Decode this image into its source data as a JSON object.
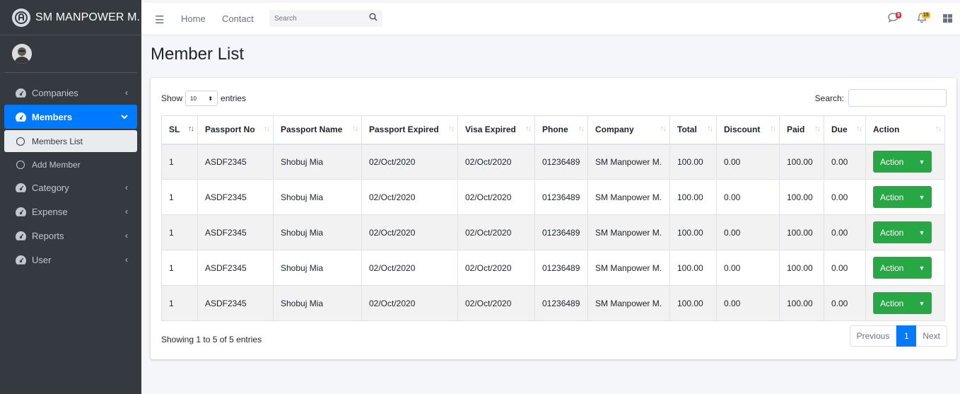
{
  "brand": {
    "name": "SM MANPOWER M."
  },
  "sidebar": {
    "items": [
      {
        "label": "Companies",
        "icon": "dashboard-icon",
        "active": false
      },
      {
        "label": "Members",
        "icon": "dashboard-icon",
        "active": true
      },
      {
        "label": "Category",
        "icon": "dashboard-icon",
        "active": false
      },
      {
        "label": "Expense",
        "icon": "dashboard-icon",
        "active": false
      },
      {
        "label": "Reports",
        "icon": "dashboard-icon",
        "active": false
      },
      {
        "label": "User",
        "icon": "dashboard-icon",
        "active": false
      }
    ],
    "subitems": [
      {
        "label": "Members List",
        "current": true
      },
      {
        "label": "Add Member",
        "current": false
      }
    ]
  },
  "topnav": {
    "home": "Home",
    "contact": "Contact",
    "search_placeholder": "Search",
    "messages_badge": "3",
    "notifications_badge": "15",
    "colors": {
      "messages_badge": "#dc3545",
      "notifications_badge": "#ffc107"
    }
  },
  "page": {
    "title": "Member List"
  },
  "table_controls": {
    "show_label": "Show",
    "entries_value": "10",
    "entries_label": "entries",
    "search_label": "Search:"
  },
  "table": {
    "columns": [
      "SL",
      "Passport No",
      "Passport Name",
      "Passport Expired",
      "Visa Expired",
      "Phone",
      "Company",
      "Total",
      "Discount",
      "Paid",
      "Due",
      "Action"
    ],
    "rows": [
      {
        "sl": "1",
        "passport_no": "ASDF2345",
        "passport_name": "Shobuj Mia",
        "passport_expired": "02/Oct/2020",
        "visa_expired": "02/Oct/2020",
        "phone": "01236489",
        "company": "SM Manpower M.",
        "total": "100.00",
        "discount": "0.00",
        "paid": "100.00",
        "due": "0.00",
        "action": "Action"
      },
      {
        "sl": "1",
        "passport_no": "ASDF2345",
        "passport_name": "Shobuj Mia",
        "passport_expired": "02/Oct/2020",
        "visa_expired": "02/Oct/2020",
        "phone": "01236489",
        "company": "SM Manpower M.",
        "total": "100.00",
        "discount": "0.00",
        "paid": "100.00",
        "due": "0.00",
        "action": "Action"
      },
      {
        "sl": "1",
        "passport_no": "ASDF2345",
        "passport_name": "Shobuj Mia",
        "passport_expired": "02/Oct/2020",
        "visa_expired": "02/Oct/2020",
        "phone": "01236489",
        "company": "SM Manpower M.",
        "total": "100.00",
        "discount": "0.00",
        "paid": "100.00",
        "due": "0.00",
        "action": "Action"
      },
      {
        "sl": "1",
        "passport_no": "ASDF2345",
        "passport_name": "Shobuj Mia",
        "passport_expired": "02/Oct/2020",
        "visa_expired": "02/Oct/2020",
        "phone": "01236489",
        "company": "SM Manpower M.",
        "total": "100.00",
        "discount": "0.00",
        "paid": "100.00",
        "due": "0.00",
        "action": "Action"
      },
      {
        "sl": "1",
        "passport_no": "ASDF2345",
        "passport_name": "Shobuj Mia",
        "passport_expired": "02/Oct/2020",
        "visa_expired": "02/Oct/2020",
        "phone": "01236489",
        "company": "SM Manpower M.",
        "total": "100.00",
        "discount": "0.00",
        "paid": "100.00",
        "due": "0.00",
        "action": "Action"
      }
    ]
  },
  "footer": {
    "info": "Showing 1 to 5 of 5 entries",
    "prev": "Previous",
    "page": "1",
    "next": "Next"
  },
  "colors": {
    "primary": "#007bff",
    "success": "#28a745",
    "sidebar_bg": "#343a40"
  }
}
